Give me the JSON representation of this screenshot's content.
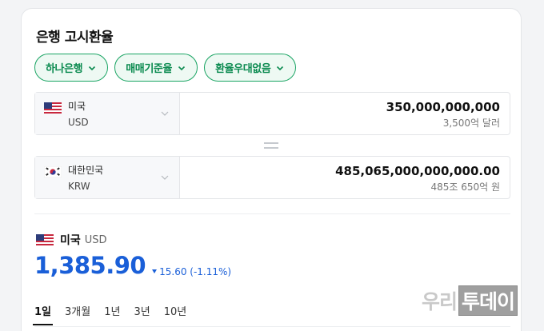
{
  "header": {
    "title": "은행 고시환율"
  },
  "filters": [
    {
      "label": "하나은행"
    },
    {
      "label": "매매기준율"
    },
    {
      "label": "환율우대없음"
    }
  ],
  "converter": {
    "from": {
      "country": "미국",
      "code": "USD",
      "amount": "350,000,000,000",
      "amount_words": "3,500억 달러"
    },
    "to": {
      "country": "대한민국",
      "code": "KRW",
      "amount": "485,065,000,000,000.00",
      "amount_words": "485조 650억 원"
    }
  },
  "rate_info": {
    "country": "미국",
    "code": "USD",
    "rate": "1,385.90",
    "change": "15.60 (-1.11%)",
    "direction": "down"
  },
  "period_tabs": [
    {
      "label": "1일",
      "active": true
    },
    {
      "label": "3개월",
      "active": false
    },
    {
      "label": "1년",
      "active": false
    },
    {
      "label": "3년",
      "active": false
    },
    {
      "label": "10년",
      "active": false
    }
  ],
  "watermark": {
    "part1": "우리",
    "part2": "투데이"
  },
  "colors": {
    "accent_green": "#19a463",
    "rate_blue": "#1a5fd8"
  },
  "icons": [
    "chevron-down-icon",
    "us-flag-icon",
    "kr-flag-icon",
    "equals-icon",
    "down-triangle-icon"
  ]
}
